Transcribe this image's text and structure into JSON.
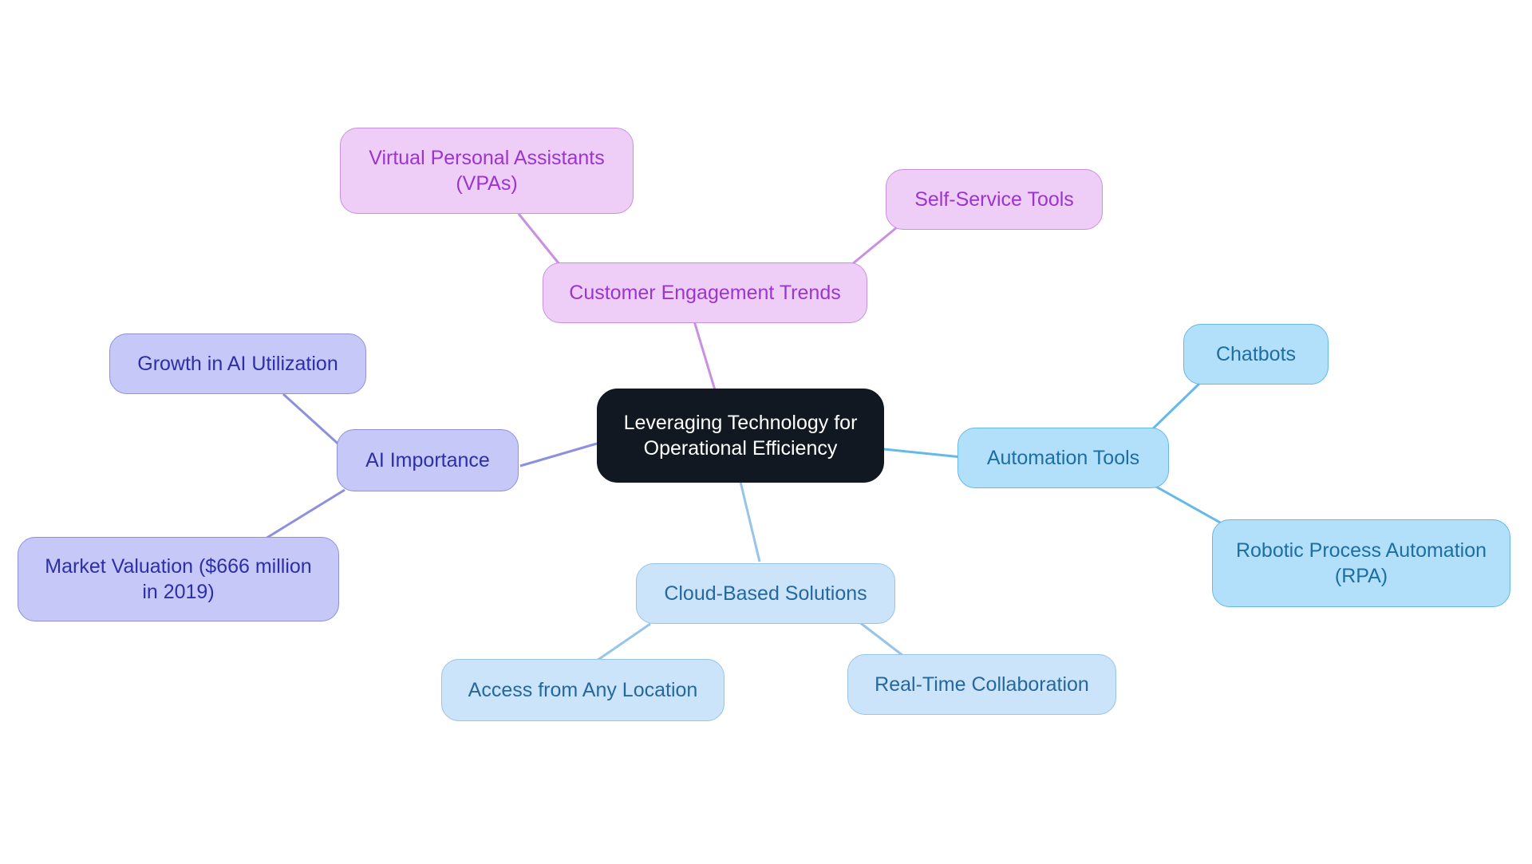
{
  "diagram": {
    "type": "mind-map",
    "title": "Leveraging Technology for Operational Efficiency",
    "background_color": "#ffffff",
    "palette": {
      "root_fill": "#111821",
      "root_text": "#ffffff",
      "violet_fill": "#c6c8f7",
      "violet_border": "#8e90de",
      "violet_text": "#2d2fa8",
      "plum_fill": "#eecdf7",
      "plum_border": "#c98fe0",
      "plum_text": "#9b35cf",
      "skyblue_fill": "#b2e0fa",
      "skyblue_border": "#64b9e8",
      "skyblue_text": "#1c6ea4",
      "paleblue_fill": "#cbe4fa",
      "paleblue_border": "#97c4e8",
      "paleblue_text": "#24689e"
    }
  },
  "nodes": {
    "root": {
      "label": "Leveraging Technology for\nOperational Efficiency"
    },
    "customer_engagement": {
      "label": "Customer Engagement Trends"
    },
    "vpas": {
      "label": "Virtual Personal Assistants\n(VPAs)"
    },
    "self_service": {
      "label": "Self-Service Tools"
    },
    "ai_importance": {
      "label": "AI Importance"
    },
    "growth_ai": {
      "label": "Growth in AI Utilization"
    },
    "market_valuation": {
      "label": "Market Valuation ($666 million\nin 2019)"
    },
    "automation_tools": {
      "label": "Automation Tools"
    },
    "chatbots": {
      "label": "Chatbots"
    },
    "rpa": {
      "label": "Robotic Process Automation\n(RPA)"
    },
    "cloud_solutions": {
      "label": "Cloud-Based Solutions"
    },
    "access_any_location": {
      "label": "Access from Any Location"
    },
    "realtime_collab": {
      "label": "Real-Time Collaboration"
    }
  },
  "edges": [
    {
      "from": "root",
      "to": "customer_engagement",
      "color": "#c98fe0"
    },
    {
      "from": "customer_engagement",
      "to": "vpas",
      "color": "#c98fe0"
    },
    {
      "from": "customer_engagement",
      "to": "self_service",
      "color": "#c98fe0"
    },
    {
      "from": "root",
      "to": "ai_importance",
      "color": "#8e90de"
    },
    {
      "from": "ai_importance",
      "to": "growth_ai",
      "color": "#8e90de"
    },
    {
      "from": "ai_importance",
      "to": "market_valuation",
      "color": "#8e90de"
    },
    {
      "from": "root",
      "to": "automation_tools",
      "color": "#64b9e8"
    },
    {
      "from": "automation_tools",
      "to": "chatbots",
      "color": "#64b9e8"
    },
    {
      "from": "automation_tools",
      "to": "rpa",
      "color": "#64b9e8"
    },
    {
      "from": "root",
      "to": "cloud_solutions",
      "color": "#97c4e8"
    },
    {
      "from": "cloud_solutions",
      "to": "access_any_location",
      "color": "#97c4e8"
    },
    {
      "from": "cloud_solutions",
      "to": "realtime_collab",
      "color": "#97c4e8"
    }
  ]
}
